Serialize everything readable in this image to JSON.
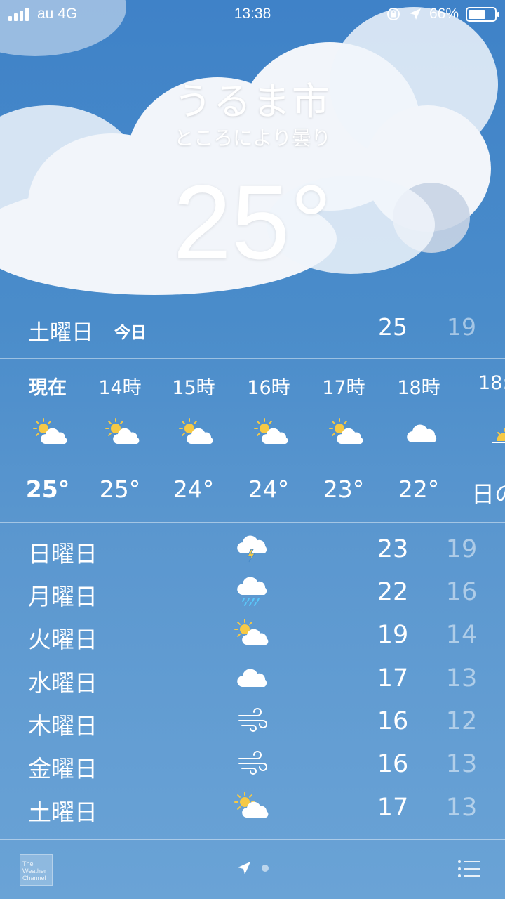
{
  "status_bar": {
    "carrier": "au 4G",
    "time": "13:38",
    "battery": "66%",
    "battery_level": 0.66,
    "icons": [
      "signal-bars-icon",
      "orientation-lock-icon",
      "location-icon",
      "battery-icon"
    ]
  },
  "location": {
    "city": "うるま市",
    "condition": "ところにより曇り",
    "current_temp": "25°"
  },
  "today": {
    "day": "土曜日",
    "label": "今日",
    "high": "25",
    "low": "19"
  },
  "hourly": [
    {
      "time": "現在",
      "icon": "partly-sunny-icon",
      "temp": "25°"
    },
    {
      "time": "14時",
      "icon": "partly-sunny-icon",
      "temp": "25°"
    },
    {
      "time": "15時",
      "icon": "partly-sunny-icon",
      "temp": "24°"
    },
    {
      "time": "16時",
      "icon": "partly-sunny-icon",
      "temp": "24°"
    },
    {
      "time": "17時",
      "icon": "partly-sunny-icon",
      "temp": "23°"
    },
    {
      "time": "18時",
      "icon": "cloud-icon",
      "temp": "22°"
    },
    {
      "time": "18:",
      "icon": "sunset-icon",
      "temp": "日の"
    }
  ],
  "daily": [
    {
      "day": "日曜日",
      "icon": "thunderstorm-icon",
      "high": "23",
      "low": "19"
    },
    {
      "day": "月曜日",
      "icon": "rain-icon",
      "high": "22",
      "low": "16"
    },
    {
      "day": "火曜日",
      "icon": "partly-sunny-icon",
      "high": "19",
      "low": "14"
    },
    {
      "day": "水曜日",
      "icon": "cloud-icon",
      "high": "17",
      "low": "13"
    },
    {
      "day": "木曜日",
      "icon": "wind-icon",
      "high": "16",
      "low": "12"
    },
    {
      "day": "金曜日",
      "icon": "wind-icon",
      "high": "16",
      "low": "13"
    },
    {
      "day": "土曜日",
      "icon": "partly-sunny-icon",
      "high": "17",
      "low": "13"
    }
  ],
  "footer": {
    "logo_text": "The Weather Channel",
    "icons": [
      "weather-channel-logo",
      "location-arrow-icon",
      "page-dot",
      "list-icon"
    ]
  },
  "colors": {
    "sky_top": "#3f82c8",
    "sky_bottom": "#6aa3d6",
    "sun": "#f6c945",
    "cloud": "#ffffff"
  }
}
